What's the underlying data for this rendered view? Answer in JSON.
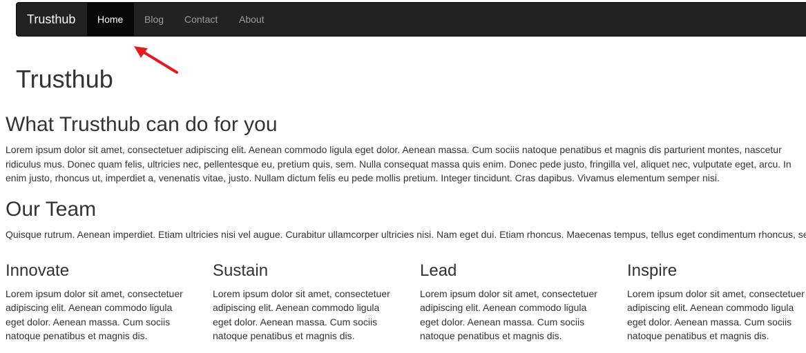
{
  "navbar": {
    "brand": "Trusthub",
    "items": [
      {
        "label": "Home",
        "active": true
      },
      {
        "label": "Blog",
        "active": false
      },
      {
        "label": "Contact",
        "active": false
      },
      {
        "label": "About",
        "active": false
      }
    ]
  },
  "annotation": {
    "arrow_color": "#e8191e"
  },
  "hero": {
    "title": "Trusthub"
  },
  "services": {
    "heading": "What Trusthub can do for you",
    "lines": [
      "Lorem ipsum dolor sit amet, consectetuer adipiscing elit. Aenean commodo ligula eget dolor. Aenean massa. Cum sociis natoque penatibus et magnis dis parturient montes, nascetur",
      "ridiculus mus. Donec quam felis, ultricies nec, pellentesque eu, pretium quis, sem. Nulla consequat massa quis enim. Donec pede justo, fringilla vel, aliquet nec, vulputate eget, arcu. In",
      "enim justo, rhoncus ut, imperdiet a, venenatis vitae, justo. Nullam dictum felis eu pede mollis pretium. Integer tincidunt. Cras dapibus. Vivamus elementum semper nisi."
    ]
  },
  "team": {
    "heading": "Our Team",
    "text": "Quisque rutrum. Aenean imperdiet. Etiam ultricies nisi vel augue. Curabitur ullamcorper ultricies nisi. Nam eget dui. Etiam rhoncus. Maecenas tempus, tellus eget condimentum rhoncus, se"
  },
  "columns": [
    {
      "title": "Innovate",
      "lines": [
        "Lorem ipsum dolor sit amet, consectetuer",
        "adipiscing elit. Aenean commodo ligula",
        "eget dolor. Aenean massa. Cum sociis",
        "natoque penatibus et magnis dis."
      ]
    },
    {
      "title": "Sustain",
      "lines": [
        "Lorem ipsum dolor sit amet, consectetuer",
        "adipiscing elit. Aenean commodo ligula",
        "eget dolor. Aenean massa. Cum sociis",
        "natoque penatibus et magnis dis."
      ]
    },
    {
      "title": "Lead",
      "lines": [
        "Lorem ipsum dolor sit amet, consectetuer",
        "adipiscing elit. Aenean commodo ligula",
        "eget dolor. Aenean massa. Cum sociis",
        "natoque penatibus et magnis dis."
      ]
    },
    {
      "title": "Inspire",
      "lines": [
        "Lorem ipsum dolor sit amet, consectetuer",
        "adipiscing elit. Aenean commodo ligula",
        "eget dolor. Aenean massa. Cum sociis",
        "natoque penatibus et magnis dis."
      ]
    }
  ]
}
